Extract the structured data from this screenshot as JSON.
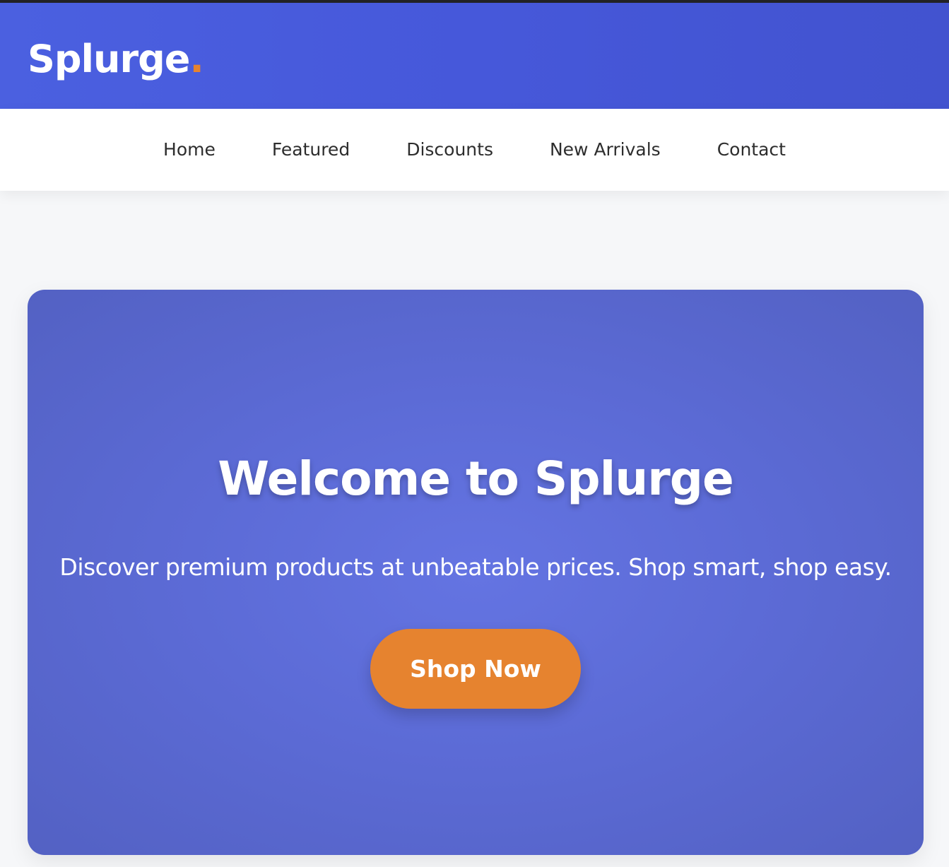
{
  "brand": {
    "name": "Splurge",
    "dot": ".",
    "accent_color": "#e6832f",
    "header_color": "#4658da"
  },
  "nav": {
    "items": [
      {
        "label": "Home"
      },
      {
        "label": "Featured"
      },
      {
        "label": "Discounts"
      },
      {
        "label": "New Arrivals"
      },
      {
        "label": "Contact"
      }
    ]
  },
  "hero": {
    "title": "Welcome to Splurge",
    "subtitle": "Discover premium products at unbeatable prices. Shop smart, shop easy.",
    "cta_label": "Shop Now",
    "background_color": "#5c6bd6"
  }
}
